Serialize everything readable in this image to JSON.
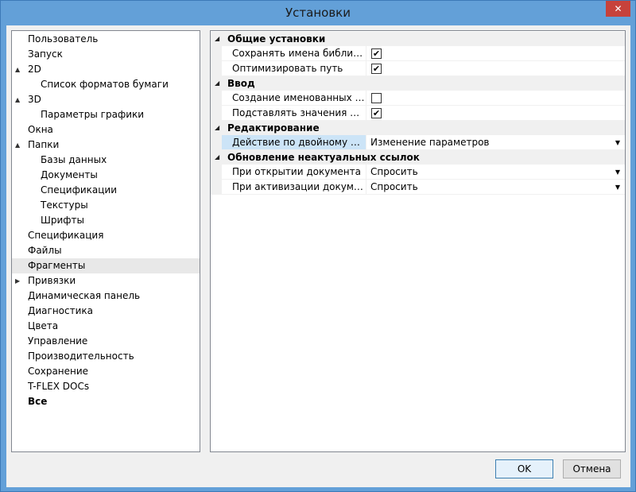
{
  "window": {
    "title": "Установки",
    "close_glyph": "✕"
  },
  "tree": {
    "items": [
      {
        "label": "Пользователь",
        "level": 0,
        "expander": "",
        "selected": false,
        "bold": false
      },
      {
        "label": "Запуск",
        "level": 0,
        "expander": "",
        "selected": false,
        "bold": false
      },
      {
        "label": "2D",
        "level": 0,
        "expander": "▲",
        "selected": false,
        "bold": false
      },
      {
        "label": "Список форматов бумаги",
        "level": 1,
        "expander": "",
        "selected": false,
        "bold": false
      },
      {
        "label": "3D",
        "level": 0,
        "expander": "▲",
        "selected": false,
        "bold": false
      },
      {
        "label": "Параметры графики",
        "level": 1,
        "expander": "",
        "selected": false,
        "bold": false
      },
      {
        "label": "Окна",
        "level": 0,
        "expander": "",
        "selected": false,
        "bold": false
      },
      {
        "label": "Папки",
        "level": 0,
        "expander": "▲",
        "selected": false,
        "bold": false
      },
      {
        "label": "Базы данных",
        "level": 1,
        "expander": "",
        "selected": false,
        "bold": false
      },
      {
        "label": "Документы",
        "level": 1,
        "expander": "",
        "selected": false,
        "bold": false
      },
      {
        "label": "Спецификации",
        "level": 1,
        "expander": "",
        "selected": false,
        "bold": false
      },
      {
        "label": "Текстуры",
        "level": 1,
        "expander": "",
        "selected": false,
        "bold": false
      },
      {
        "label": "Шрифты",
        "level": 1,
        "expander": "",
        "selected": false,
        "bold": false
      },
      {
        "label": "Спецификация",
        "level": 0,
        "expander": "",
        "selected": false,
        "bold": false
      },
      {
        "label": "Файлы",
        "level": 0,
        "expander": "",
        "selected": false,
        "bold": false
      },
      {
        "label": "Фрагменты",
        "level": 0,
        "expander": "",
        "selected": true,
        "bold": false
      },
      {
        "label": "Привязки",
        "level": 0,
        "expander": "▶",
        "selected": false,
        "bold": false
      },
      {
        "label": "Динамическая панель",
        "level": 0,
        "expander": "",
        "selected": false,
        "bold": false
      },
      {
        "label": "Диагностика",
        "level": 0,
        "expander": "",
        "selected": false,
        "bold": false
      },
      {
        "label": "Цвета",
        "level": 0,
        "expander": "",
        "selected": false,
        "bold": false
      },
      {
        "label": "Управление",
        "level": 0,
        "expander": "",
        "selected": false,
        "bold": false
      },
      {
        "label": "Производительность",
        "level": 0,
        "expander": "",
        "selected": false,
        "bold": false
      },
      {
        "label": "Сохранение",
        "level": 0,
        "expander": "",
        "selected": false,
        "bold": false
      },
      {
        "label": "T-FLEX DOCs",
        "level": 0,
        "expander": "",
        "selected": false,
        "bold": false
      },
      {
        "label": "Все",
        "level": 0,
        "expander": "",
        "selected": false,
        "bold": true
      }
    ]
  },
  "grid": {
    "rows": [
      {
        "kind": "category",
        "label": "Общие установки",
        "expander": "◢"
      },
      {
        "kind": "check",
        "name": "Сохранять имена библиотек",
        "checked": true
      },
      {
        "kind": "check",
        "name": "Оптимизировать путь",
        "checked": true
      },
      {
        "kind": "category",
        "label": "Ввод",
        "expander": "◢"
      },
      {
        "kind": "check",
        "name": "Создание именованных узлов",
        "checked": false
      },
      {
        "kind": "check",
        "name": "Подставлять значения переменных",
        "checked": true
      },
      {
        "kind": "category",
        "label": "Редактирование",
        "expander": "◢"
      },
      {
        "kind": "dropdown",
        "name": "Действие по двойному клику",
        "value": "Изменение параметров",
        "selected": true
      },
      {
        "kind": "category",
        "label": "Обновление неактуальных ссылок",
        "expander": "◢"
      },
      {
        "kind": "dropdown",
        "name": "При открытии документа",
        "value": "Спросить",
        "selected": false
      },
      {
        "kind": "dropdown",
        "name": "При активизации документа",
        "value": "Спросить",
        "selected": false
      }
    ],
    "check_glyph": "✔",
    "dropdown_glyph": "▼"
  },
  "buttons": {
    "ok": "OK",
    "cancel": "Отмена"
  }
}
